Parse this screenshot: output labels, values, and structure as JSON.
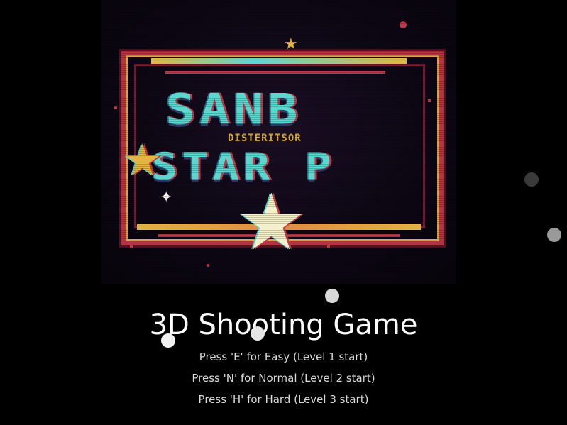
{
  "game": {
    "title": "3D Shooting Game",
    "difficulty_options": [
      {
        "key": "E",
        "text": "Press 'E' for Easy (Level 1 start)"
      },
      {
        "key": "N",
        "text": "Press 'N' for Normal (Level 2 start)"
      },
      {
        "key": "H",
        "text": "Press 'H' for Hard (Level 3 start)"
      }
    ]
  },
  "title_art": {
    "line1": "SANB",
    "line2": "STAR P",
    "tagline": "DISTERITSOR"
  },
  "colors": {
    "background": "#000000",
    "title_text": "#ffffff",
    "menu_text": "#d9d9d9",
    "art_cyan": "#57d9cf",
    "art_red": "#b8323f",
    "art_gold": "#e6b53c",
    "particle_light": "#dcdcdc",
    "particle_dark": "#3a3a3a"
  }
}
